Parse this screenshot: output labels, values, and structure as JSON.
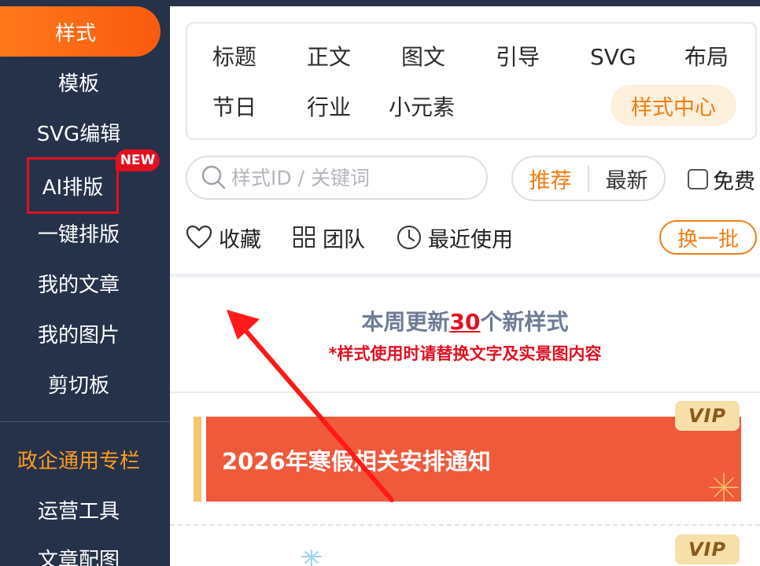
{
  "sidebar": {
    "items": [
      {
        "label": "样式"
      },
      {
        "label": "模板"
      },
      {
        "label": "SVG编辑"
      },
      {
        "label": "AI排版"
      },
      {
        "label": "一键排版"
      },
      {
        "label": "我的文章"
      },
      {
        "label": "我的图片"
      },
      {
        "label": "剪切板"
      },
      {
        "label": "政企通用专栏"
      },
      {
        "label": "运营工具"
      },
      {
        "label": "文章配图"
      }
    ],
    "new_badge": "NEW"
  },
  "categories": {
    "row1": [
      "标题",
      "正文",
      "图文",
      "引导",
      "SVG",
      "布局"
    ],
    "row2": [
      "节日",
      "行业",
      "小元素"
    ],
    "style_center": "样式中心"
  },
  "search": {
    "placeholder": "样式ID / 关键词"
  },
  "sort": {
    "recommend": "推荐",
    "latest": "最新"
  },
  "free_label": "免费",
  "actions": {
    "favorites": "收藏",
    "team": "团队",
    "recent": "最近使用",
    "swap": "换一批"
  },
  "update": {
    "prefix": "本周更新",
    "count": "30",
    "suffix": "个新样式",
    "note": "*样式使用时请替换文字及实景图内容"
  },
  "cards": [
    {
      "title": "2026年寒假相关安排通知",
      "badge": "VIP"
    },
    {
      "badge": "VIP"
    }
  ],
  "colors": {
    "sidebar_bg": "#25324a",
    "accent_orange": "#f27c13",
    "highlight_red": "#e1101f",
    "card_red": "#ef5a3b"
  }
}
